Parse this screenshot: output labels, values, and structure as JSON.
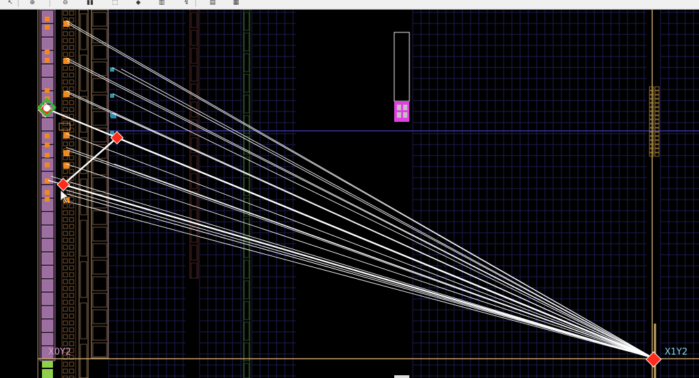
{
  "toolbar": {
    "buttons": [
      {
        "name": "select-tool-icon",
        "glyph": "↖"
      },
      {
        "name": "zoom-in-icon",
        "glyph": "⊕"
      },
      {
        "name": "zoom-out-icon",
        "glyph": "⊖"
      },
      {
        "name": "fit-icon",
        "glyph": "▮▮"
      },
      {
        "name": "zoom-area-icon",
        "glyph": "⬚"
      },
      {
        "name": "autofit-icon",
        "glyph": "◆"
      },
      {
        "name": "chart-icon",
        "glyph": "▥"
      },
      {
        "name": "route-icon",
        "glyph": "↯"
      },
      {
        "name": "properties-icon",
        "glyph": "▤"
      },
      {
        "name": "screenshot-icon",
        "glyph": "▦"
      }
    ]
  },
  "regions": {
    "left_label": "X0Y2",
    "right_label": "X1Y2",
    "left_color": "#d8a0c8",
    "right_color": "#7fd6e6"
  },
  "colors": {
    "background": "#000000",
    "clock_region_border": "#c8a46a",
    "net_line": "#ffffff",
    "source_marker": "#ff2b1a",
    "selected_marker": "#2fbf2f",
    "cell_highlight": "#f08a1e",
    "bram_column": "#9c6fa0",
    "grid": "#1c1c55",
    "pblock": "#e040e0"
  }
}
